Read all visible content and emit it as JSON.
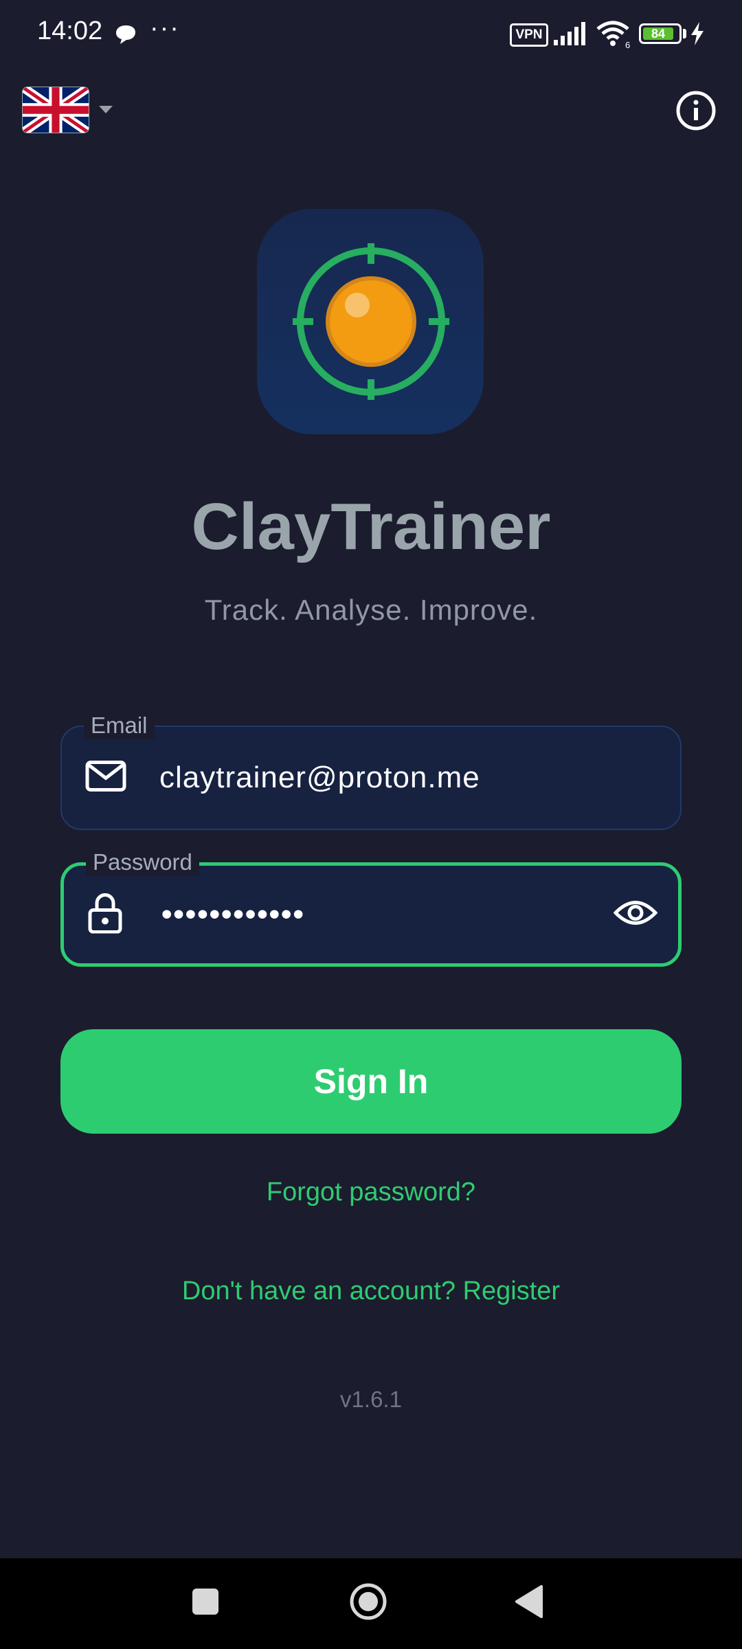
{
  "status_bar": {
    "time": "14:02",
    "dots": "···",
    "vpn": "VPN",
    "battery": "84"
  },
  "top_bar": {
    "language": "English (UK)",
    "language_flag": "uk-flag-icon",
    "info_icon": "info-icon"
  },
  "brand": {
    "app_name": "ClayTrainer",
    "tagline": "Track. Analyse. Improve.",
    "logo_icon": "crosshair-target-icon"
  },
  "form": {
    "email": {
      "label": "Email",
      "value": "claytrainer@proton.me",
      "icon": "mail-icon"
    },
    "password": {
      "label": "Password",
      "masked_value": "••••••••••••",
      "icon": "lock-icon",
      "toggle_icon": "eye-icon"
    },
    "sign_in_label": "Sign In",
    "forgot_label": "Forgot password?",
    "register_label": "Don't have an account? Register"
  },
  "version": "v1.6.1",
  "colors": {
    "background": "#1b1c2e",
    "accent": "#2ecc71",
    "field_bg": "#172140",
    "logo_orange": "#f39c12"
  }
}
